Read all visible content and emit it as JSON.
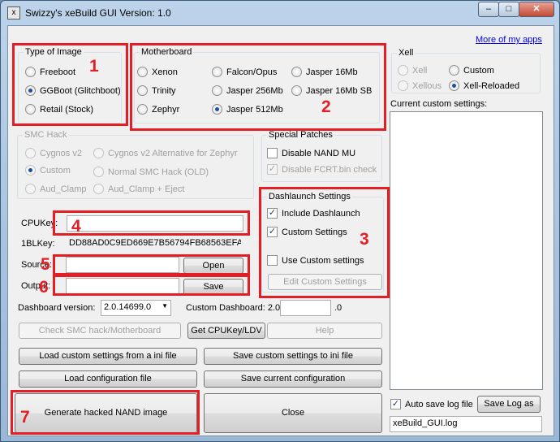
{
  "window": {
    "title": "Swizzy's xeBuild GUI Version: 1.0",
    "app_icon": "x"
  },
  "titlebar": {
    "minimize": "–",
    "maximize": "□",
    "close": "✕"
  },
  "more_apps_link": "More of my apps",
  "type_of_image": {
    "legend": "Type of Image",
    "options": [
      "Freeboot",
      "GGBoot (Glitchboot)",
      "Retail (Stock)"
    ],
    "selected": "GGBoot (Glitchboot)"
  },
  "motherboard": {
    "legend": "Motherboard",
    "options": [
      "Xenon",
      "Trinity",
      "Zephyr",
      "Falcon/Opus",
      "Jasper 256Mb",
      "Jasper 512Mb",
      "Jasper 16Mb",
      "Jasper 16Mb SB"
    ],
    "selected": "Jasper 512Mb"
  },
  "xell": {
    "legend": "Xell",
    "options": [
      "Xell",
      "Xellous",
      "Custom",
      "Xell-Reloaded"
    ],
    "selected": "Xell-Reloaded"
  },
  "current_custom_settings_label": "Current custom settings:",
  "smc_hack": {
    "legend": "SMC Hack",
    "options": [
      "Cygnos v2",
      "Custom",
      "Aud_Clamp",
      "Cygnos v2 Alternative for Zephyr",
      "Normal SMC Hack (OLD)",
      "Aud_Clamp + Eject"
    ],
    "selected": "Custom"
  },
  "special_patches": {
    "legend": "Special Patches",
    "disable_nand_mu": "Disable NAND MU",
    "disable_fcrt": "Disable FCRT.bin check"
  },
  "dashlaunch": {
    "legend": "Dashlaunch Settings",
    "include": "Include Dashlaunch",
    "custom_settings": "Custom Settings",
    "use_custom": "Use Custom settings",
    "edit_button": "Edit Custom Settings"
  },
  "fields": {
    "cpukey_label": "CPUKey:",
    "cpukey_value": "",
    "onebl_label": "1BLKey:",
    "onebl_value": "DD88AD0C9ED669E7B56794FB68563EFA",
    "source_label": "Source:",
    "source_value": "",
    "output_label": "Output:",
    "output_value": "",
    "open_button": "Open",
    "save_button": "Save"
  },
  "dashboard": {
    "label": "Dashboard version:",
    "selected": "2.0.14699.0",
    "custom_label": "Custom Dashboard: 2.0.",
    "custom_value": "",
    "suffix": ".0"
  },
  "buttons": {
    "check_smc": "Check SMC hack/Motherboard",
    "get_cpukey": "Get CPUKey/LDV",
    "help": "Help",
    "load_custom_ini": "Load custom settings from a ini file",
    "save_custom_ini": "Save custom settings to ini file",
    "load_config": "Load configuration file",
    "save_config": "Save current configuration",
    "generate": "Generate hacked NAND image",
    "close": "Close",
    "save_log_as": "Save Log as"
  },
  "log": {
    "auto_save_label": "Auto save log file",
    "filename": "xeBuild_GUI.log"
  },
  "annotations": {
    "n1": "1",
    "n2": "2",
    "n3": "3",
    "n4": "4",
    "n5": "5",
    "n6": "6",
    "n7": "7"
  },
  "colors": {
    "annotation_red": "#e31e24",
    "link_blue": "#0000ee"
  }
}
